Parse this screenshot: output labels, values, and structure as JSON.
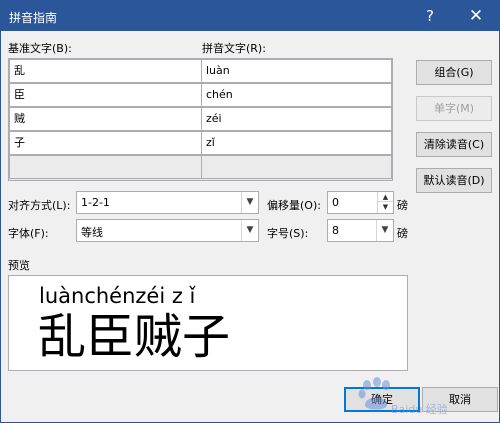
{
  "window": {
    "title": "拼音指南",
    "help_glyph": "?",
    "close_glyph": "✕"
  },
  "labels": {
    "base_text": "基准文字(B):",
    "pinyin_text": "拼音文字(R):",
    "alignment": "对齐方式(L):",
    "offset": "偏移量(O):",
    "font": "字体(F):",
    "size": "字号(S):",
    "unit_pt": "磅",
    "preview": "预览"
  },
  "rows": [
    {
      "base": "乱",
      "pinyin": "luàn"
    },
    {
      "base": "臣",
      "pinyin": "chén"
    },
    {
      "base": "贼",
      "pinyin": "zéi"
    },
    {
      "base": "子",
      "pinyin": "zǐ"
    },
    {
      "base": "",
      "pinyin": ""
    }
  ],
  "buttons": {
    "combine": "组合(G)",
    "single": "单字(M)",
    "clear": "清除读音(C)",
    "default_reading": "默认读音(D)",
    "ok": "确定",
    "cancel": "取消"
  },
  "fields": {
    "alignment": "1-2-1",
    "offset": "0",
    "font": "等线",
    "size": "8"
  },
  "preview": {
    "pinyin": "luànchénzéi z ǐ",
    "hanzi": "乱臣贼子"
  },
  "watermark": {
    "text": "Baidu 经验"
  },
  "colors": {
    "titlebar": "#2b579a",
    "accent": "#0078d7"
  }
}
